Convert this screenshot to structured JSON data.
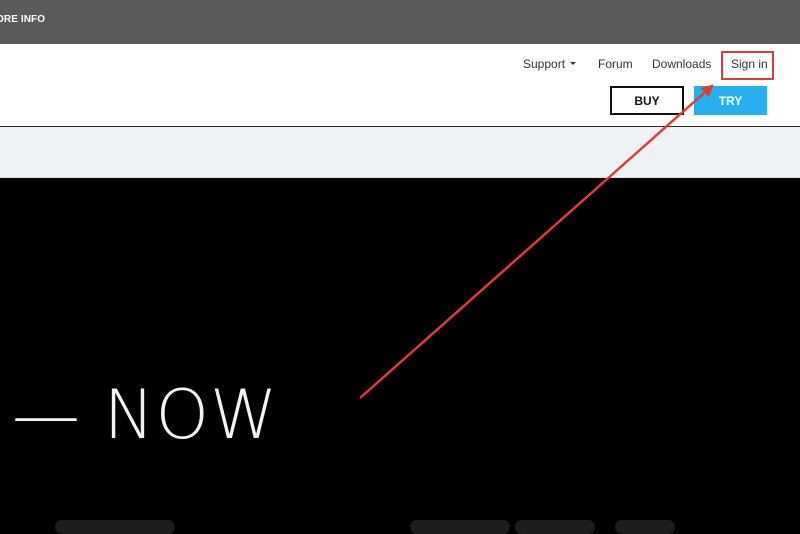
{
  "topbar": {
    "more_info": "ORE INFO"
  },
  "nav": {
    "support": "Support",
    "forum": "Forum",
    "downloads": "Downloads",
    "sign_in": "Sign in"
  },
  "actions": {
    "buy": "BUY",
    "try": "TRY"
  },
  "hero": {
    "headline": "— NOW"
  },
  "colors": {
    "topbar": "#5a5a5a",
    "try_button": "#27b0f0",
    "annotation": "#e23a3a",
    "subbar": "#eff2f5"
  }
}
